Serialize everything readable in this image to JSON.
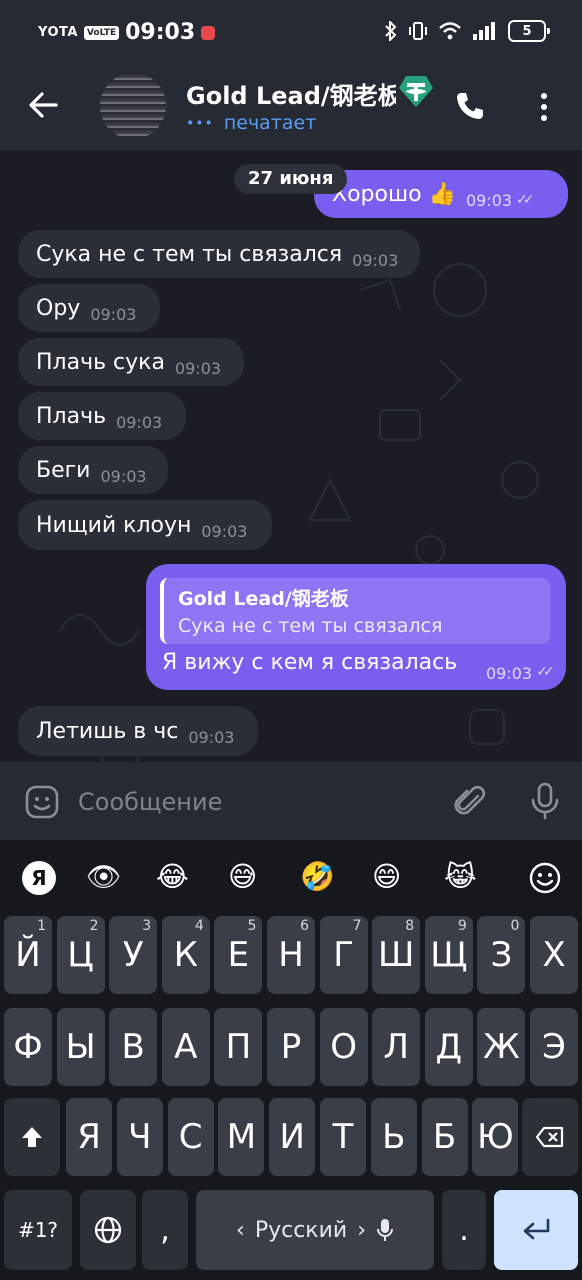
{
  "status_bar": {
    "carrier": "YOTA",
    "volte": "VoLTE",
    "time": "09:03",
    "battery": "5"
  },
  "header": {
    "title": "Gold Lead/钢老板",
    "status": "печатает",
    "status_dots": "•••"
  },
  "chat": {
    "date": "27 июня",
    "messages": [
      {
        "dir": "out",
        "text": "Хорошо 👍",
        "time": "09:03"
      },
      {
        "dir": "in",
        "text": "Сука не с тем ты связался",
        "time": "09:03"
      },
      {
        "dir": "in",
        "text": "Ору",
        "time": "09:03"
      },
      {
        "dir": "in",
        "text": "Плачь сука",
        "time": "09:03"
      },
      {
        "dir": "in",
        "text": "Плачь",
        "time": "09:03"
      },
      {
        "dir": "in",
        "text": "Беги",
        "time": "09:03"
      },
      {
        "dir": "in",
        "text": "Нищий клоун",
        "time": "09:03"
      },
      {
        "dir": "in",
        "text": "Летишь в чс",
        "time": "09:03"
      }
    ],
    "reply": {
      "quote_name": "Gold Lead/钢老板",
      "quote_text": "Сука не с тем ты связался",
      "text": "Я вижу с кем я связалась",
      "time": "09:03"
    },
    "ticks": "✓✓"
  },
  "input": {
    "placeholder": "Сообщение"
  },
  "keyboard": {
    "ya_label": "Я",
    "emoji_row": [
      "👁",
      "😂",
      "😅",
      "🤣",
      "😄",
      "😹"
    ],
    "row1": [
      {
        "k": "Й",
        "n": "1"
      },
      {
        "k": "Ц",
        "n": "2"
      },
      {
        "k": "У",
        "n": "3"
      },
      {
        "k": "К",
        "n": "4"
      },
      {
        "k": "Е",
        "n": "5"
      },
      {
        "k": "Н",
        "n": "6"
      },
      {
        "k": "Г",
        "n": "7"
      },
      {
        "k": "Ш",
        "n": "8"
      },
      {
        "k": "Щ",
        "n": "9"
      },
      {
        "k": "З",
        "n": "0"
      },
      {
        "k": "Х",
        "n": ""
      }
    ],
    "row2": [
      "Ф",
      "Ы",
      "В",
      "А",
      "П",
      "Р",
      "О",
      "Л",
      "Д",
      "Ж",
      "Э"
    ],
    "row3": [
      "Я",
      "Ч",
      "С",
      "М",
      "И",
      "Т",
      "Ь",
      "Б",
      "Ю"
    ],
    "symbols_label": "#1?",
    "comma": ",",
    "space_label": "Русский",
    "space_left": "‹",
    "space_right": "›",
    "period": "."
  },
  "colors": {
    "outgoing_bubble": "#7a5ef0",
    "incoming_bubble": "#2a2f37",
    "typing_status": "#5b9bf0",
    "enter_key": "#cfe3ff"
  }
}
